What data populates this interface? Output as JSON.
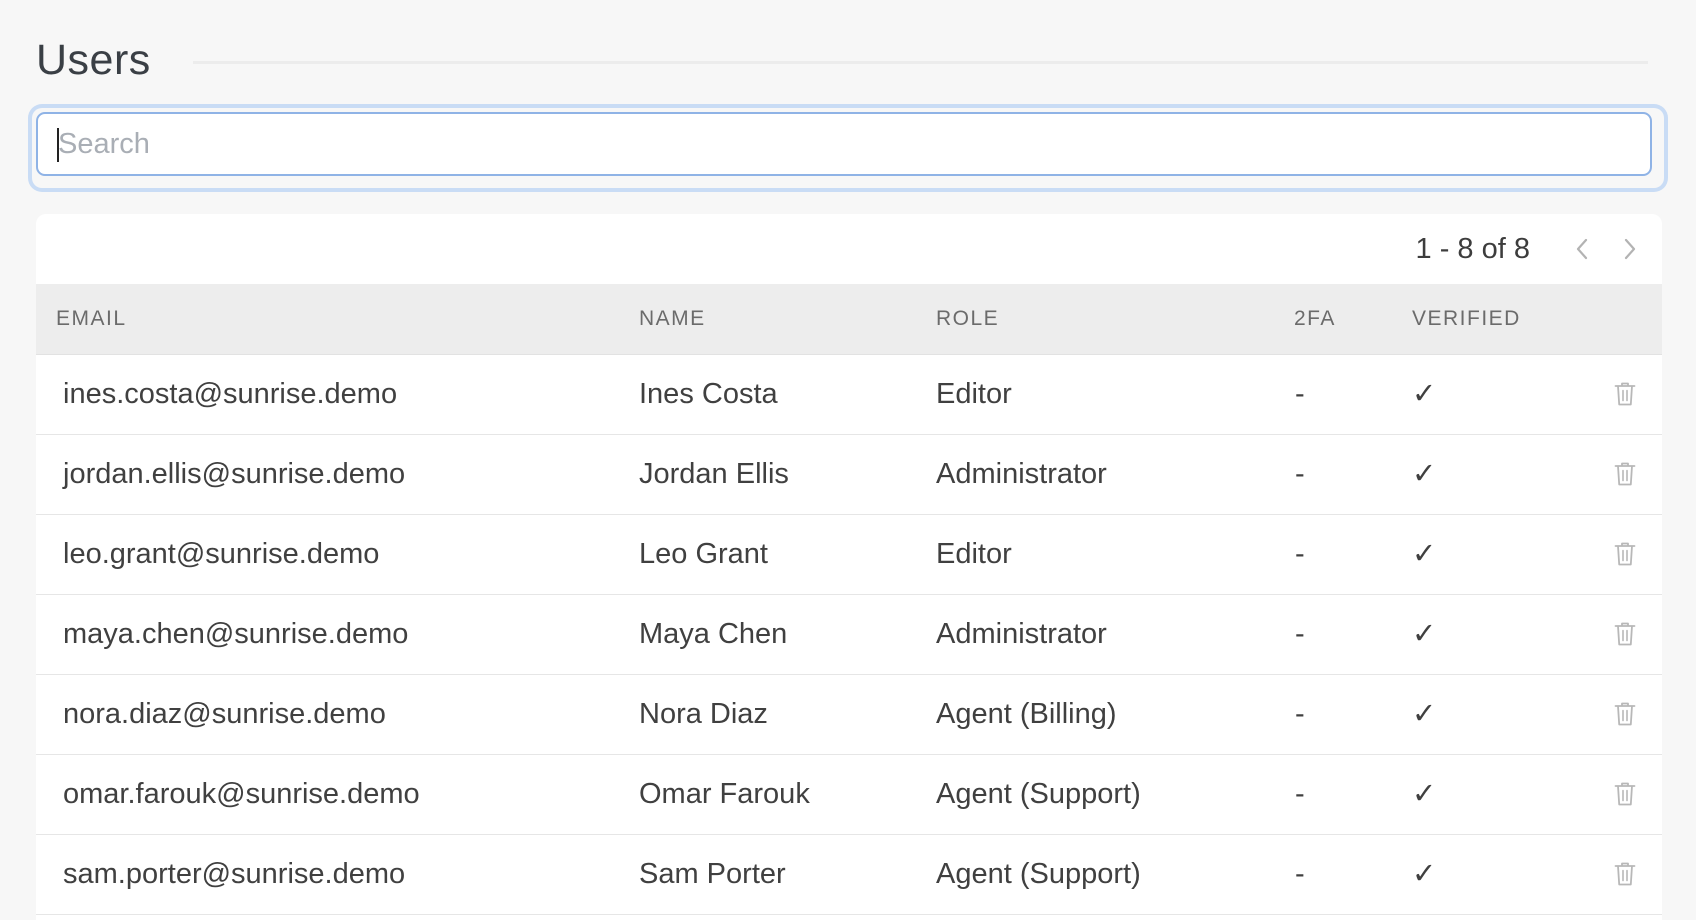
{
  "page": {
    "title": "Users"
  },
  "search": {
    "placeholder": "Search",
    "value": ""
  },
  "pagination": {
    "range_text": "1 - 8 of 8",
    "prev_icon": "chevron-left-icon",
    "next_icon": "chevron-right-icon"
  },
  "table": {
    "columns": {
      "email": "EMAIL",
      "name": "NAME",
      "role": "ROLE",
      "twofa": "2FA",
      "verified": "VERIFIED"
    },
    "rows": [
      {
        "email": "ines.costa@sunrise.demo",
        "name": "Ines Costa",
        "role": "Editor",
        "twofa": "-",
        "verified": "✓"
      },
      {
        "email": "jordan.ellis@sunrise.demo",
        "name": "Jordan Ellis",
        "role": "Administrator",
        "twofa": "-",
        "verified": "✓"
      },
      {
        "email": "leo.grant@sunrise.demo",
        "name": "Leo Grant",
        "role": "Editor",
        "twofa": "-",
        "verified": "✓"
      },
      {
        "email": "maya.chen@sunrise.demo",
        "name": "Maya Chen",
        "role": "Administrator",
        "twofa": "-",
        "verified": "✓"
      },
      {
        "email": "nora.diaz@sunrise.demo",
        "name": "Nora Diaz",
        "role": "Agent (Billing)",
        "twofa": "-",
        "verified": "✓"
      },
      {
        "email": "omar.farouk@sunrise.demo",
        "name": "Omar Farouk",
        "role": "Agent (Support)",
        "twofa": "-",
        "verified": "✓"
      },
      {
        "email": "sam.porter@sunrise.demo",
        "name": "Sam Porter",
        "role": "Agent (Support)",
        "twofa": "-",
        "verified": "✓"
      }
    ],
    "row_action_icon": "trash-icon"
  },
  "colors": {
    "background": "#f7f7f7",
    "card": "#ffffff",
    "header_row": "#ededed",
    "focus_ring": "#c9dcf5",
    "input_border": "#8fb3e6",
    "text": "#404040",
    "muted_icon": "#b8b8b8"
  }
}
